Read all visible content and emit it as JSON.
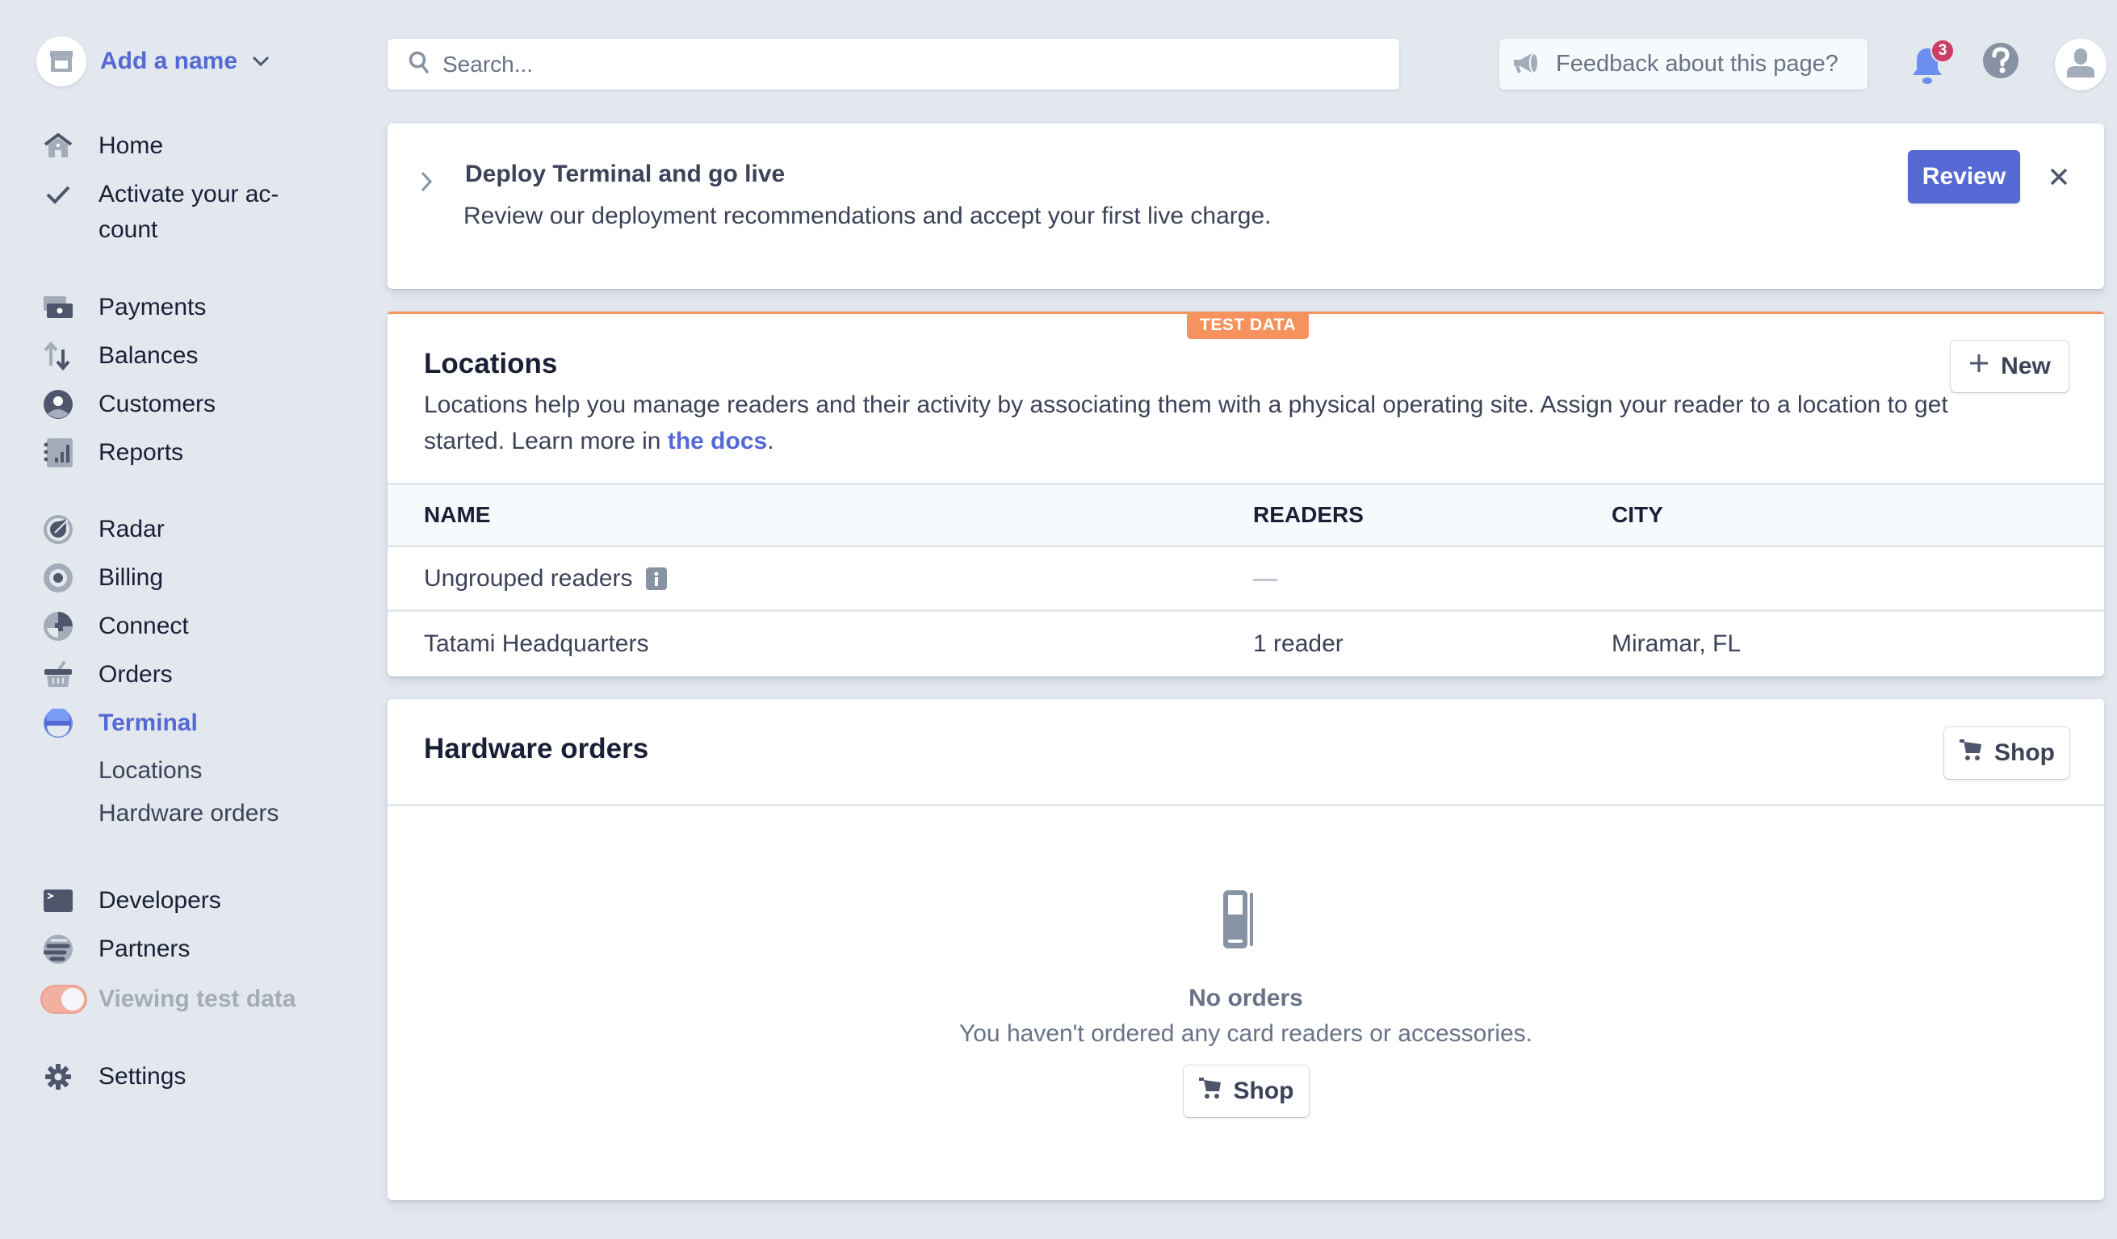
{
  "account": {
    "name": "Add a name",
    "icon": "store-icon",
    "dropdown_icon": "chevron-down-icon"
  },
  "sidebar": {
    "items": [
      {
        "label": "Home",
        "icon": "home-icon"
      },
      {
        "label": "Activate your ac-\ncount",
        "icon": "check-icon"
      },
      {
        "label": "Payments",
        "icon": "payments-icon"
      },
      {
        "label": "Balances",
        "icon": "balances-icon"
      },
      {
        "label": "Customers",
        "icon": "customers-icon"
      },
      {
        "label": "Reports",
        "icon": "reports-icon"
      },
      {
        "label": "Radar",
        "icon": "radar-icon"
      },
      {
        "label": "Billing",
        "icon": "billing-icon"
      },
      {
        "label": "Connect",
        "icon": "connect-icon"
      },
      {
        "label": "Orders",
        "icon": "orders-icon"
      },
      {
        "label": "Terminal",
        "icon": "terminal-icon",
        "active": true
      },
      {
        "label": "Developers",
        "icon": "developers-icon"
      },
      {
        "label": "Partners",
        "icon": "partners-icon"
      },
      {
        "label": "Settings",
        "icon": "settings-icon"
      }
    ],
    "terminal_subitems": [
      {
        "label": "Locations"
      },
      {
        "label": "Hardware orders"
      }
    ],
    "test_data_toggle": {
      "label": "Viewing test data",
      "on": true
    }
  },
  "topbar": {
    "search": {
      "placeholder": "Search...",
      "value": ""
    },
    "feedback_label": "Feedback about this page?",
    "notifications_count": "3"
  },
  "banner": {
    "title": "Deploy Terminal and go live",
    "description": "Review our deployment recommendations and accept your first live charge.",
    "review_label": "Review"
  },
  "locations": {
    "badge": "TEST DATA",
    "title": "Locations",
    "description_before": "Locations help you manage readers and their activity by associating them with a physical operating site. Assign your reader to a location to get started. Learn more in ",
    "docs_link": "the docs",
    "description_after": ".",
    "new_label": "New",
    "columns": [
      "NAME",
      "READERS",
      "CITY"
    ],
    "rows": [
      {
        "name": "Ungrouped readers",
        "readers": "—",
        "city": "",
        "info": true
      },
      {
        "name": "Tatami Headquarters",
        "readers": "1 reader",
        "city": "Miramar, FL",
        "info": false
      }
    ]
  },
  "hardware_orders": {
    "title": "Hardware orders",
    "shop_label": "Shop",
    "empty_title": "No orders",
    "empty_description": "You haven't ordered any card readers or accessories.",
    "empty_shop_label": "Shop"
  },
  "colors": {
    "accent": "#5469d4",
    "test_data": "#f5925e",
    "badge_red": "#cd3d64",
    "background": "#e3e8ef"
  }
}
